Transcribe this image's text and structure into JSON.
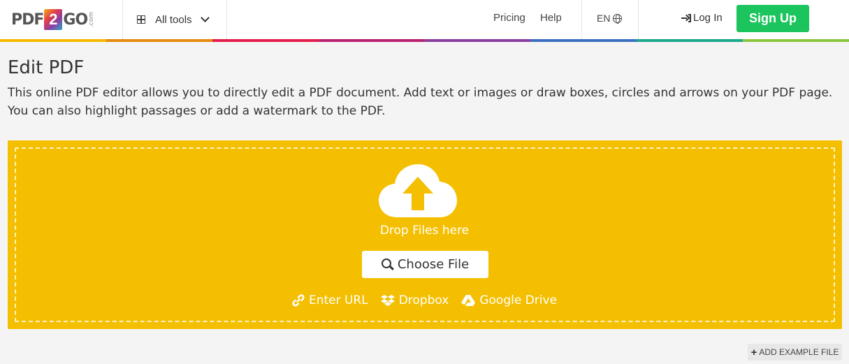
{
  "header": {
    "logo": {
      "left": "PDF",
      "two": "2",
      "right": "GO",
      "com": ".com"
    },
    "all_tools": "All tools",
    "nav": {
      "pricing": "Pricing",
      "help": "Help"
    },
    "language": "EN",
    "login": "Log In",
    "signup": "Sign Up"
  },
  "colors": {
    "brand_bar": [
      "#f5b800",
      "#e68a10",
      "#e31e4d",
      "#b8226f",
      "#8a3d9e",
      "#3d6fc1",
      "#1aa98b",
      "#8cc63f"
    ],
    "dropzone": "#f4bf00",
    "signup": "#1bc45d"
  },
  "page": {
    "title": "Edit PDF",
    "description": "This online PDF editor allows you to directly edit a PDF document. Add text or images or draw boxes, circles and arrows on your PDF page. You can also highlight passages or add a watermark to the PDF."
  },
  "upload": {
    "drop_text": "Drop Files here",
    "choose_file": "Choose File",
    "sources": {
      "url": "Enter URL",
      "dropbox": "Dropbox",
      "gdrive": "Google Drive"
    },
    "add_example": "ADD EXAMPLE FILE"
  },
  "icons": [
    "grid-icon",
    "chevron-down-icon",
    "globe-icon",
    "login-icon",
    "cloud-upload-icon",
    "search-icon",
    "link-icon",
    "dropbox-icon",
    "google-drive-icon",
    "plus-icon"
  ]
}
